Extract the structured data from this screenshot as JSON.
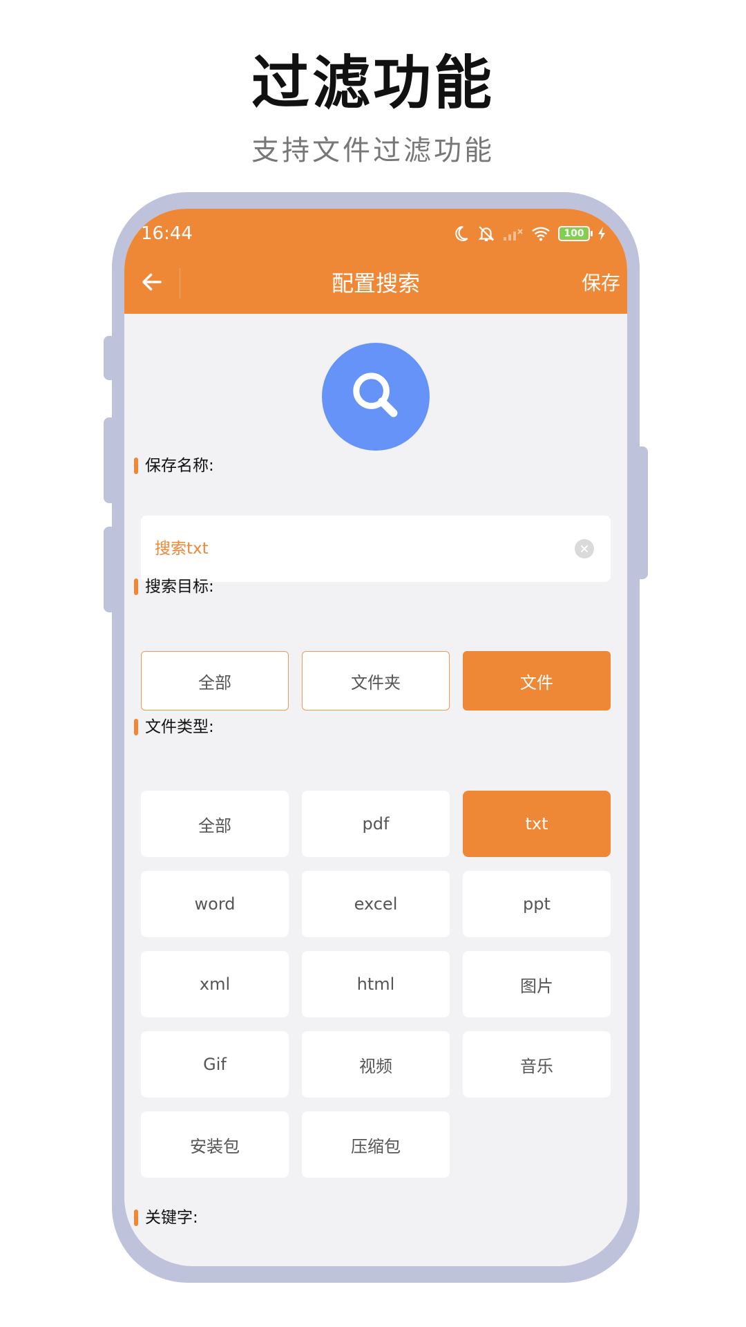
{
  "promo": {
    "title": "过滤功能",
    "subtitle": "支持文件过滤功能"
  },
  "status_bar": {
    "time": "16:44",
    "battery": "100",
    "icons": [
      "moon-icon",
      "mute-bell-icon",
      "signal-icon",
      "wifi-icon",
      "battery-icon",
      "charging-icon"
    ]
  },
  "appbar": {
    "title": "配置搜索",
    "save_label": "保存",
    "back_icon": "back-arrow-icon",
    "color": "#ef8836"
  },
  "search_badge": {
    "icon": "search-icon",
    "color": "#6693f8"
  },
  "save_name": {
    "label": "保存名称:",
    "value": "搜索txt",
    "clear_icon": "clear-icon"
  },
  "search_target": {
    "label": "搜索目标:",
    "options": [
      "全部",
      "文件夹",
      "文件"
    ],
    "selected": "文件"
  },
  "file_type": {
    "label": "文件类型:",
    "options": [
      "全部",
      "pdf",
      "txt",
      "word",
      "excel",
      "ppt",
      "xml",
      "html",
      "图片",
      "Gif",
      "视频",
      "音乐",
      "安装包",
      "压缩包"
    ],
    "selected": "txt"
  },
  "keyword": {
    "label": "关键字:"
  }
}
